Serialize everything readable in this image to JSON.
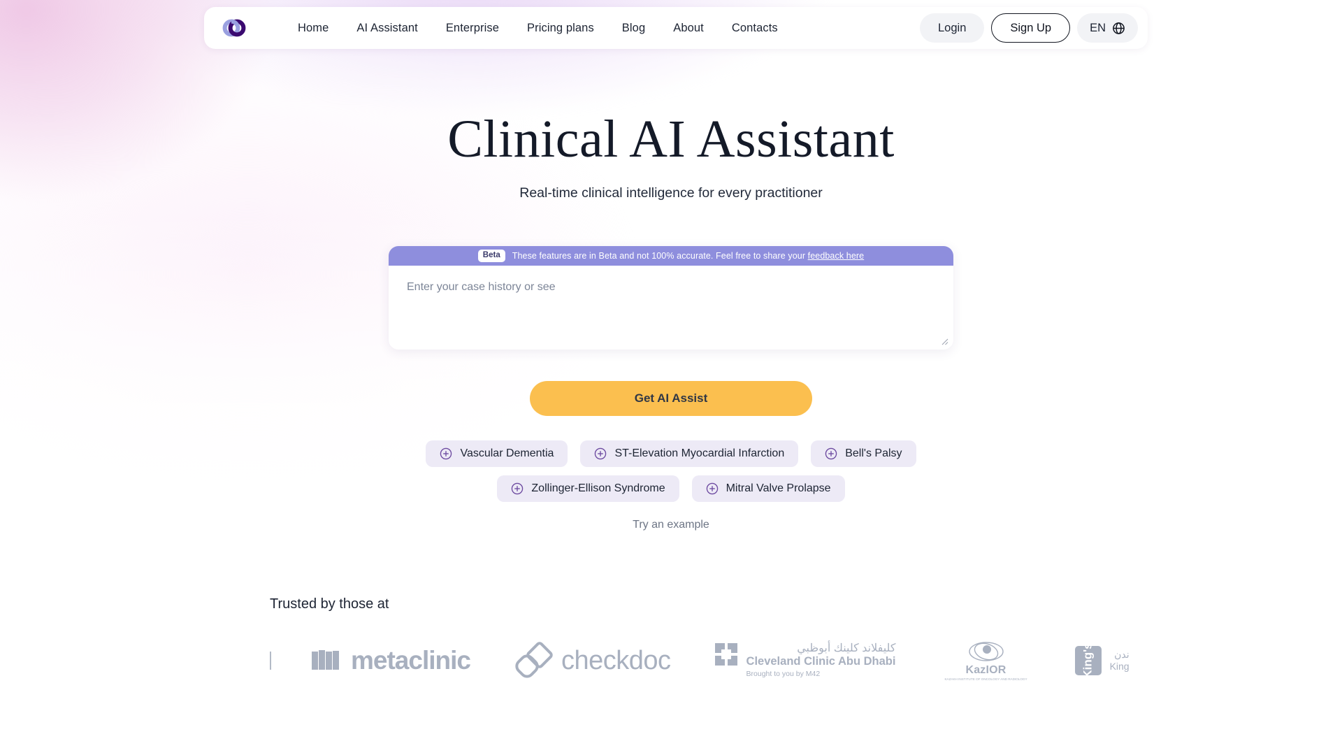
{
  "nav": {
    "logo_icon": "interlocking-rings-logo",
    "links": [
      {
        "label": "Home"
      },
      {
        "label": "AI Assistant"
      },
      {
        "label": "Enterprise"
      },
      {
        "label": "Pricing plans"
      },
      {
        "label": "Blog"
      },
      {
        "label": "About"
      },
      {
        "label": "Contacts"
      }
    ],
    "login_label": "Login",
    "signup_label": "Sign Up",
    "language_label": "EN",
    "language_icon": "globe-icon"
  },
  "hero": {
    "title": "Clinical AI Assistant",
    "subtitle": "Real-time clinical intelligence for every practitioner"
  },
  "beta": {
    "badge": "Beta",
    "message": "These features are in Beta and not 100% accurate. Feel free to share your ",
    "link_label": "feedback here"
  },
  "case_input": {
    "placeholder": "Enter your case history or see",
    "value": "",
    "resize_handle_icon": "resize-grip-icon"
  },
  "cta": {
    "label": "Get AI Assist",
    "color": "#fbbf4f"
  },
  "suggestions": {
    "plus_icon": "plus-circle-icon",
    "row1": [
      {
        "label": "Vascular Dementia"
      },
      {
        "label": "ST-Elevation Myocardial Infarction"
      },
      {
        "label": "Bell's Palsy"
      }
    ],
    "row2": [
      {
        "label": "Zollinger-Ellison Syndrome"
      },
      {
        "label": "Mitral Valve Prolapse"
      }
    ],
    "try_example_label": "Try an example"
  },
  "trusted": {
    "title": "Trusted by those at",
    "logos": [
      {
        "name": "metaclinic",
        "word": "metaclinic"
      },
      {
        "name": "checkdoc",
        "word": "checkdoc"
      },
      {
        "name": "cleveland-clinic-abu-dhabi",
        "arabic": "كليفلاند كلينك أبوظبي",
        "english": "Cleveland Clinic Abu Dhabi",
        "tagline": "Brought to you by M42"
      },
      {
        "name": "kazior",
        "word": "KazIOR",
        "tagline": "KAZAKH INSTITUTE OF ONCOLOGY AND RADIOLOGY"
      },
      {
        "name": "kings",
        "mark": "King's",
        "arabic": "ندن",
        "english": "King"
      }
    ]
  },
  "colors": {
    "accent_purple": "#3b0a70",
    "accent_light_purple": "#8e8edd",
    "cta_yellow": "#fbbf4f",
    "chip_bg": "#edeaf6",
    "logo_gray": "#a8b0bf"
  }
}
